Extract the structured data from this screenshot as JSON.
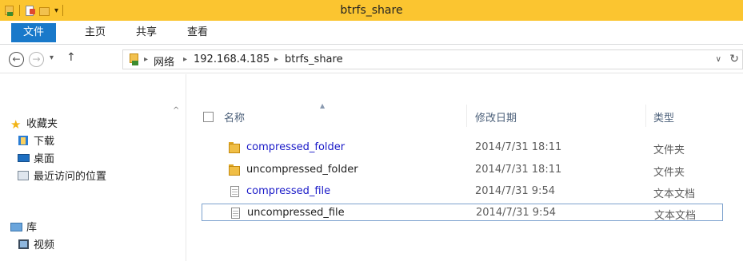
{
  "window": {
    "title": "btrfs_share"
  },
  "quick_access": {
    "icons": [
      "folder-up-icon",
      "new-document-icon",
      "new-folder-icon",
      "customize-dropdown-icon"
    ],
    "dropdown_glyph": "▾"
  },
  "ribbon": {
    "tabs": [
      {
        "label": "文件",
        "active": true,
        "color": "#1979ca"
      },
      {
        "label": "主页"
      },
      {
        "label": "共享"
      },
      {
        "label": "查看"
      }
    ]
  },
  "nav": {
    "back": "←",
    "forward": "→",
    "history": "▾",
    "up": "↑"
  },
  "address": {
    "crumbs": [
      "网络",
      "192.168.4.185",
      "btrfs_share"
    ],
    "separator": "▸",
    "dropdown": "∨",
    "refresh": "↻"
  },
  "navpane": {
    "favorites_label": "收藏夹",
    "items": [
      "下载",
      "桌面",
      "最近访问的位置"
    ],
    "library_label": "库",
    "library_items": [
      "视频"
    ],
    "collapse_glyph": "^"
  },
  "columns": {
    "name": "名称",
    "modified": "修改日期",
    "type": "类型",
    "sort_glyph": "▲"
  },
  "files": [
    {
      "name": "compressed_folder",
      "modified": "2014/7/31 18:11",
      "type": "文件夹",
      "kind": "folder",
      "compressed": true
    },
    {
      "name": "uncompressed_folder",
      "modified": "2014/7/31 18:11",
      "type": "文件夹",
      "kind": "folder",
      "compressed": false
    },
    {
      "name": "compressed_file",
      "modified": "2014/7/31 9:54",
      "type": "文本文档",
      "kind": "file",
      "compressed": true
    },
    {
      "name": "uncompressed_file",
      "modified": "2014/7/31 9:54",
      "type": "文本文档",
      "kind": "file",
      "compressed": false,
      "focused": true
    }
  ],
  "colors": {
    "titlebar": "#fbc530",
    "file_tab": "#1979ca",
    "compressed_text": "#1a1ac8",
    "focus_border": "#7da2ce"
  }
}
